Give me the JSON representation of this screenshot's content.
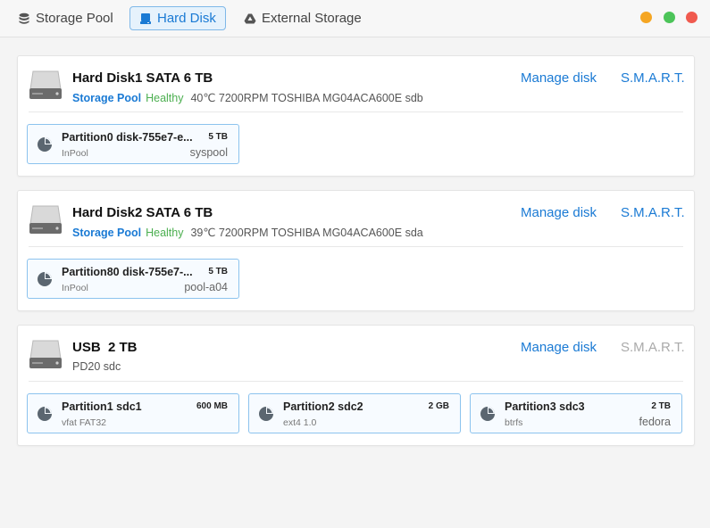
{
  "tabs": {
    "storage_pool": "Storage Pool",
    "hard_disk": "Hard Disk",
    "external_storage": "External Storage"
  },
  "window_controls": {
    "minimize_color": "#f5a623",
    "maximize_color": "#4cc459",
    "close_color": "#f05a4f"
  },
  "colors": {
    "accent": "#1a7ad4",
    "healthy": "#4caf50"
  },
  "actions": {
    "manage": "Manage disk",
    "smart": "S.M.A.R.T."
  },
  "disks": [
    {
      "title": "Hard Disk1 SATA 6 TB",
      "pool_label": "Storage Pool",
      "health": "Healthy",
      "details": "40℃ 7200RPM TOSHIBA MG04ACA600E sdb",
      "partitions": [
        {
          "name": "Partition0 disk-755e7-e...",
          "size": "5 TB",
          "fs": "InPool",
          "pool": "syspool"
        }
      ]
    },
    {
      "title": "Hard Disk2 SATA 6 TB",
      "pool_label": "Storage Pool",
      "health": "Healthy",
      "details": "39℃ 7200RPM TOSHIBA MG04ACA600E sda",
      "partitions": [
        {
          "name": "Partition80 disk-755e7-...",
          "size": "5 TB",
          "fs": "InPool",
          "pool": "pool-a04"
        }
      ]
    },
    {
      "title": "USB  2 TB",
      "details": "PD20 sdc",
      "smart_enabled": false,
      "partitions": [
        {
          "name": "Partition1 sdc1",
          "size": "600 MB",
          "fs": "vfat FAT32",
          "pool": ""
        },
        {
          "name": "Partition2 sdc2",
          "size": "2 GB",
          "fs": "ext4 1.0",
          "pool": ""
        },
        {
          "name": "Partition3 sdc3",
          "size": "2 TB",
          "fs": "btrfs",
          "pool": "fedora"
        }
      ]
    }
  ]
}
